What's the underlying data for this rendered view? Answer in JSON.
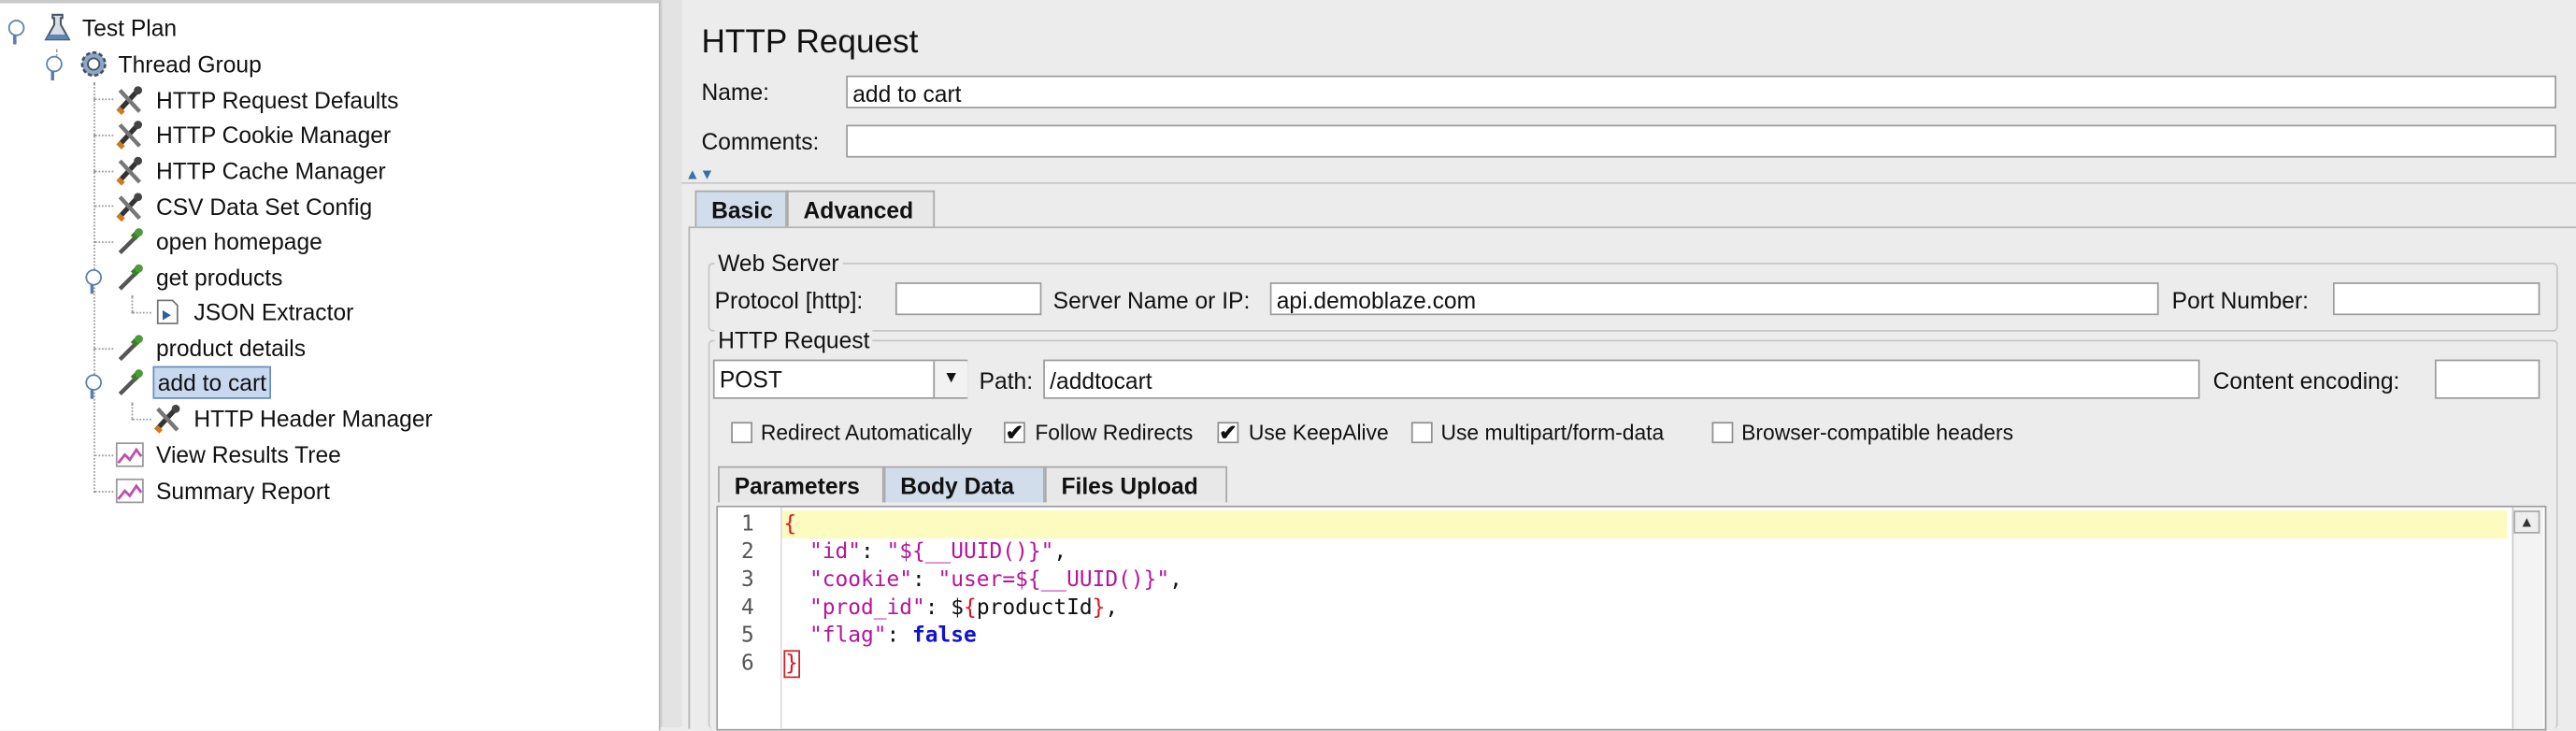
{
  "tree": {
    "test_plan": "Test Plan",
    "thread_group": "Thread Group",
    "items": [
      "HTTP Request Defaults",
      "HTTP Cookie Manager",
      "HTTP Cache Manager",
      "CSV Data Set Config",
      "open homepage",
      "get products",
      "JSON Extractor",
      "product details",
      "add to cart",
      "HTTP Header Manager",
      "View Results Tree",
      "Summary Report"
    ]
  },
  "panel": {
    "title": "HTTP Request",
    "name_label": "Name:",
    "name_value": "add to cart",
    "comments_label": "Comments:",
    "comments_value": "",
    "tabs": [
      "Basic",
      "Advanced"
    ],
    "web_server": {
      "legend": "Web Server",
      "protocol_label": "Protocol [http]:",
      "protocol_value": "",
      "server_label": "Server Name or IP:",
      "server_value": "api.demoblaze.com",
      "port_label": "Port Number:",
      "port_value": ""
    },
    "http_request": {
      "legend": "HTTP Request",
      "method": "POST",
      "path_label": "Path:",
      "path_value": "/addtocart",
      "encoding_label": "Content encoding:",
      "encoding_value": ""
    },
    "checkboxes": [
      {
        "label": "Redirect Automatically",
        "checked": false
      },
      {
        "label": "Follow Redirects",
        "checked": true
      },
      {
        "label": "Use KeepAlive",
        "checked": true
      },
      {
        "label": "Use multipart/form-data",
        "checked": false
      },
      {
        "label": "Browser-compatible headers",
        "checked": false
      }
    ],
    "subtabs": [
      "Parameters",
      "Body Data",
      "Files Upload"
    ],
    "check_mark": "✔"
  },
  "editor": {
    "line_numbers": [
      "1",
      "2",
      "3",
      "4",
      "5",
      "6"
    ],
    "lines": [
      {
        "a": "{"
      },
      {
        "a": "  ",
        "k": "\"id\"",
        "s": ": ",
        "v": "\"${__UUID()}\"",
        "e": ","
      },
      {
        "a": "  ",
        "k": "\"cookie\"",
        "s": ": ",
        "v": "\"user=${__UUID()}\"",
        "e": ","
      },
      {
        "a": "  ",
        "k": "\"prod_id\"",
        "s": ": $",
        "b1": "{",
        "m": "productId",
        "b2": "}",
        "e": ","
      },
      {
        "a": "  ",
        "k": "\"flag\"",
        "s": ": ",
        "kw": "false"
      },
      {
        "a": "}"
      }
    ]
  }
}
